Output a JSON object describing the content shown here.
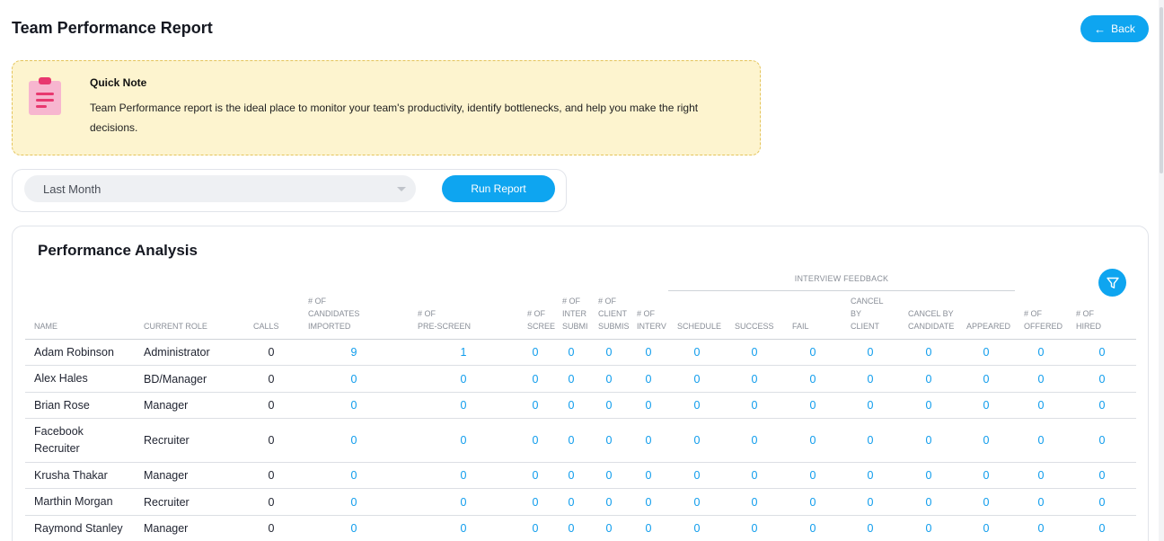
{
  "page": {
    "title": "Team Performance Report",
    "back_label": "Back"
  },
  "note": {
    "title": "Quick Note",
    "text": "Team Performance report is the ideal place to monitor your team's productivity, identify bottlenecks, and help you make the right decisions."
  },
  "filter": {
    "selected": "Last Month",
    "run_label": "Run Report"
  },
  "analysis": {
    "title": "Performance Analysis",
    "group_label": "INTERVIEW FEEDBACK",
    "columns": [
      {
        "label": [
          "NAME"
        ]
      },
      {
        "label": [
          "CURRENT ROLE"
        ]
      },
      {
        "label": [
          "CALLS"
        ]
      },
      {
        "label": [
          "# OF",
          "CANDIDATES",
          "IMPORTED"
        ]
      },
      {
        "label": [
          "# OF",
          "PRE-SCREEN"
        ]
      },
      {
        "label": [
          "# OF",
          "SCREE"
        ]
      },
      {
        "label": [
          "# OF",
          "INTER",
          "SUBMI"
        ]
      },
      {
        "label": [
          "# OF",
          "CLIENT",
          "SUBMIS"
        ]
      },
      {
        "label": [
          "# OF",
          "INTERV"
        ]
      },
      {
        "label": [
          "SCHEDULE"
        ]
      },
      {
        "label": [
          "SUCCESS"
        ]
      },
      {
        "label": [
          "FAIL"
        ]
      },
      {
        "label": [
          "CANCEL",
          "BY",
          "CLIENT"
        ]
      },
      {
        "label": [
          "CANCEL BY",
          "CANDIDATE"
        ]
      },
      {
        "label": [
          "APPEARED"
        ]
      },
      {
        "label": [
          "# OF",
          "OFFERED"
        ]
      },
      {
        "label": [
          "# OF",
          "HIRED"
        ]
      }
    ],
    "rows": [
      {
        "name": "Adam Robinson",
        "role": "Administrator",
        "values": [
          "0",
          "9",
          "1",
          "0",
          "0",
          "0",
          "0",
          "0",
          "0",
          "0",
          "0",
          "0",
          "0",
          "0",
          "0"
        ]
      },
      {
        "name": "Alex Hales",
        "role": "BD/Manager",
        "values": [
          "0",
          "0",
          "0",
          "0",
          "0",
          "0",
          "0",
          "0",
          "0",
          "0",
          "0",
          "0",
          "0",
          "0",
          "0"
        ]
      },
      {
        "name": "Brian Rose",
        "role": "Manager",
        "values": [
          "0",
          "0",
          "0",
          "0",
          "0",
          "0",
          "0",
          "0",
          "0",
          "0",
          "0",
          "0",
          "0",
          "0",
          "0"
        ]
      },
      {
        "name": "Facebook Recruiter",
        "role": "Recruiter",
        "values": [
          "0",
          "0",
          "0",
          "0",
          "0",
          "0",
          "0",
          "0",
          "0",
          "0",
          "0",
          "0",
          "0",
          "0",
          "0"
        ]
      },
      {
        "name": "Krusha Thakar",
        "role": "Manager",
        "values": [
          "0",
          "0",
          "0",
          "0",
          "0",
          "0",
          "0",
          "0",
          "0",
          "0",
          "0",
          "0",
          "0",
          "0",
          "0"
        ]
      },
      {
        "name": "Marthin Morgan",
        "role": "Recruiter",
        "values": [
          "0",
          "0",
          "0",
          "0",
          "0",
          "0",
          "0",
          "0",
          "0",
          "0",
          "0",
          "0",
          "0",
          "0",
          "0"
        ]
      },
      {
        "name": "Raymond Stanley",
        "role": "Manager",
        "values": [
          "0",
          "0",
          "0",
          "0",
          "0",
          "0",
          "0",
          "0",
          "0",
          "0",
          "0",
          "0",
          "0",
          "0",
          "0"
        ]
      }
    ]
  },
  "colors": {
    "accent": "#0ea5f0",
    "note_bg": "#fdf4cf",
    "link": "#0e9cec"
  },
  "icons": {
    "back": "arrow-left-icon",
    "note": "clipboard-icon",
    "filter": "funnel-icon",
    "select": "chevron-down-icon"
  }
}
